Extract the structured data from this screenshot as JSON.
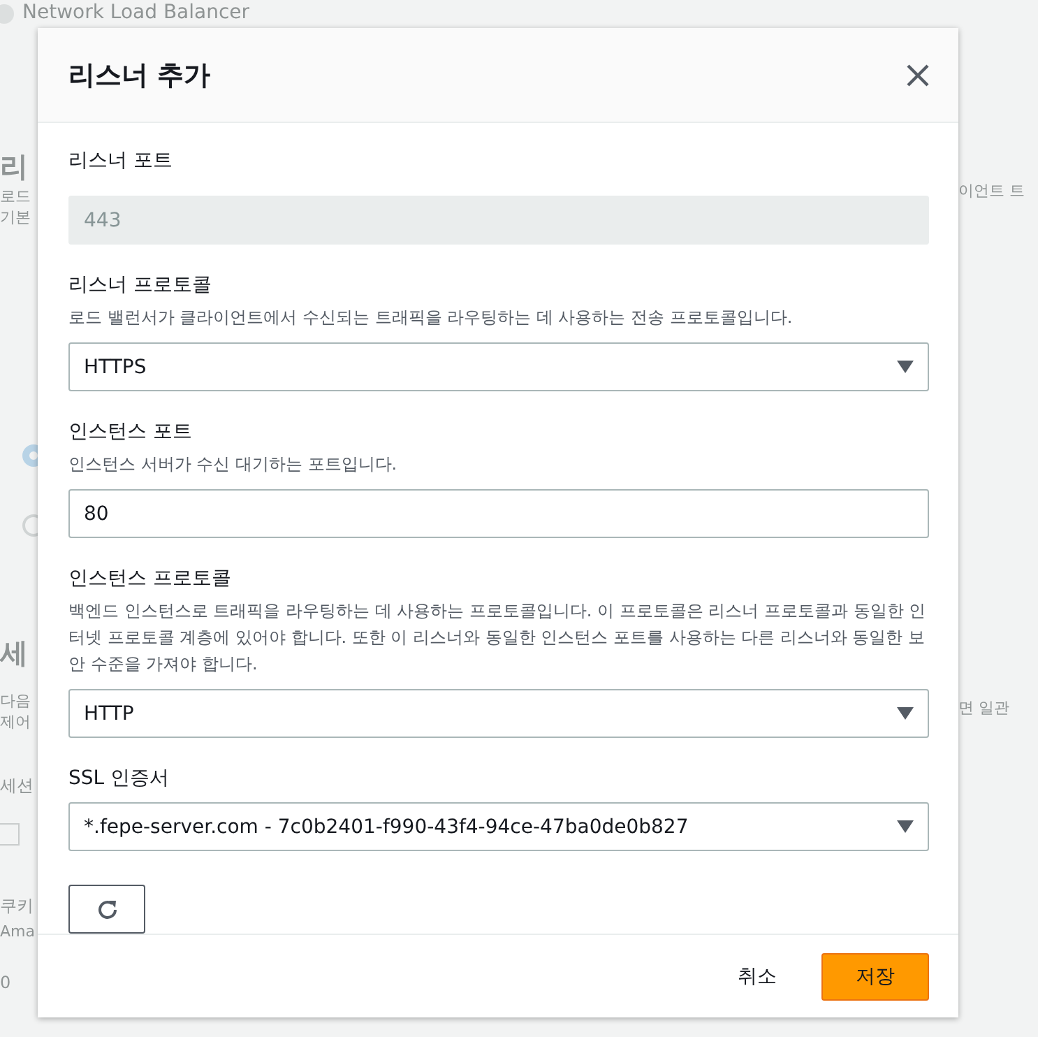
{
  "background": {
    "title": "Network Load Balancer",
    "left_fragments": [
      {
        "kind": "heading",
        "text": "리"
      },
      {
        "kind": "small",
        "text": "로드"
      },
      {
        "kind": "small",
        "text": "기본"
      },
      {
        "kind": "radio",
        "selected": true
      },
      {
        "kind": "radio",
        "selected": false
      },
      {
        "kind": "heading",
        "text": "세"
      },
      {
        "kind": "small",
        "text": "다음"
      },
      {
        "kind": "small",
        "text": "제어"
      },
      {
        "kind": "label",
        "text": "세션"
      },
      {
        "kind": "checkbox",
        "checked": false
      },
      {
        "kind": "label",
        "text": "쿠키"
      },
      {
        "kind": "small",
        "text": "Ama"
      },
      {
        "kind": "label",
        "text": "0"
      }
    ],
    "right_fragments": [
      {
        "kind": "small",
        "text": "이언트 트"
      },
      {
        "kind": "small",
        "text": "면 일관"
      }
    ]
  },
  "modal": {
    "title": "리스너 추가",
    "fields": [
      {
        "kind": "readonly",
        "label": "리스너 포트",
        "value": "443",
        "disabled": true
      },
      {
        "kind": "select",
        "label": "리스너 프로토콜",
        "description": "로드 밸런서가 클라이언트에서 수신되는 트래픽을 라우팅하는 데 사용하는 전송 프로토콜입니다.",
        "value": "HTTPS"
      },
      {
        "kind": "input",
        "label": "인스턴스 포트",
        "description": "인스턴스 서버가 수신 대기하는 포트입니다.",
        "value": "80"
      },
      {
        "kind": "select",
        "label": "인스턴스 프로토콜",
        "description": "백엔드 인스턴스로 트래픽을 라우팅하는 데 사용하는 프로토콜입니다. 이 프로토콜은 리스너 프로토콜과 동일한 인터넷 프로토콜 계층에 있어야 합니다. 또한 이 리스너와 동일한 인스턴스 포트를 사용하는 다른 리스너와 동일한 보안 수준을 가져야 합니다.",
        "value": "HTTP"
      },
      {
        "kind": "select",
        "label": "SSL 인증서",
        "value": "*.fepe-server.com - 7c0b2401-f990-43f4-94ce-47ba0de0b827"
      }
    ],
    "cancel": "취소",
    "save": "저장"
  }
}
